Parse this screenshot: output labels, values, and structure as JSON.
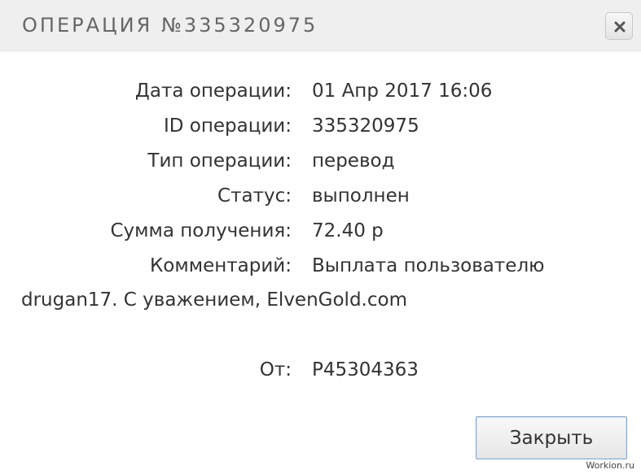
{
  "dialog": {
    "title": "ОПЕРАЦИЯ №335320975",
    "close_icon": "close-x-icon"
  },
  "details": [
    {
      "label": "Дата операции:",
      "value": "01 Апр 2017 16:06"
    },
    {
      "label": "ID операции:",
      "value": "335320975"
    },
    {
      "label": "Тип операции:",
      "value": "перевод"
    },
    {
      "label": "Статус:",
      "value": "выполнен"
    },
    {
      "label": "Сумма получения:",
      "value": "72.40 р"
    },
    {
      "label": "Комментарий:",
      "value": "Выплата пользователю"
    }
  ],
  "comment_continuation": "drugan17. С уважением, ElvenGold.com",
  "from": {
    "label": "От:",
    "value": "P45304363"
  },
  "buttons": {
    "close_label": "Закрыть"
  },
  "watermark": "Workion.ru"
}
